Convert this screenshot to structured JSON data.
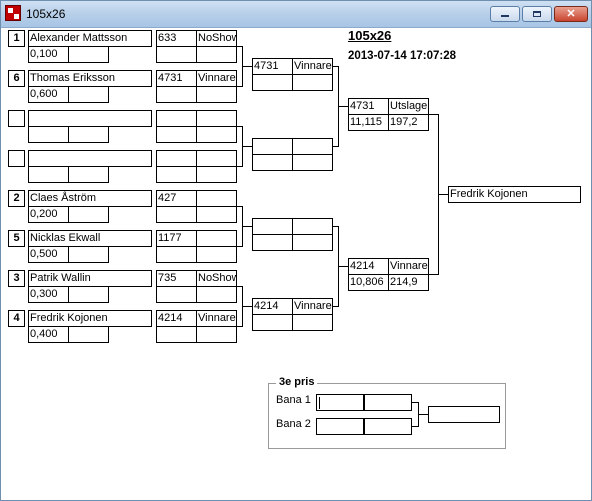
{
  "window": {
    "title": "105x26"
  },
  "header": {
    "event": "105x26",
    "datetime": "2013-07-14 17:07:28"
  },
  "round1": [
    {
      "seed": "1",
      "name": "Alexander Mattsson",
      "time": "0,100",
      "num": "633",
      "status": "NoShow"
    },
    {
      "seed": "6",
      "name": "Thomas Eriksson",
      "time": "0,600",
      "num": "4731",
      "status": "Vinnare"
    },
    {
      "seed": "",
      "name": "",
      "time": "",
      "num": "",
      "status": ""
    },
    {
      "seed": "",
      "name": "",
      "time": "",
      "num": "",
      "status": ""
    },
    {
      "seed": "2",
      "name": "Claes Åström",
      "time": "0,200",
      "num": "427",
      "status": ""
    },
    {
      "seed": "5",
      "name": "Nicklas Ekwall",
      "time": "0,500",
      "num": "1177",
      "status": ""
    },
    {
      "seed": "3",
      "name": "Patrik Wallin",
      "time": "0,300",
      "num": "735",
      "status": "NoShow"
    },
    {
      "seed": "4",
      "name": "Fredrik Kojonen",
      "time": "0,400",
      "num": "4214",
      "status": "Vinnare"
    }
  ],
  "round2": [
    {
      "num": "4731",
      "status": "Vinnare"
    },
    {
      "num": "",
      "status": ""
    },
    {
      "num": "",
      "status": ""
    },
    {
      "num": "4214",
      "status": "Vinnare"
    }
  ],
  "semis": [
    {
      "num": "4731",
      "status": "Utslagen",
      "et": "11,115",
      "speed": "197,2"
    },
    {
      "num": "4214",
      "status": "Vinnare",
      "et": "10,806",
      "speed": "214,9"
    }
  ],
  "winner": {
    "name": "Fredrik Kojonen"
  },
  "third_place": {
    "title": "3e pris",
    "lane1_label": "Bana 1",
    "lane2_label": "Bana 2",
    "lane1_num": "",
    "lane1_status": "",
    "lane2_num": "",
    "lane2_status": "",
    "result": ""
  }
}
